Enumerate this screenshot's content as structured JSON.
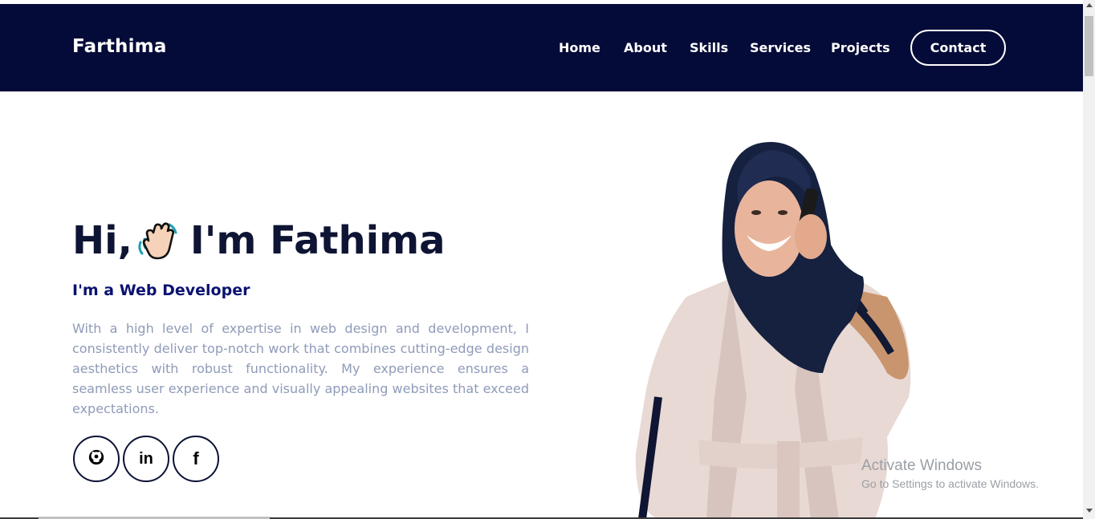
{
  "brand": "Farthima",
  "nav": {
    "home": "Home",
    "about": "About",
    "skills": "Skills",
    "services": "Services",
    "projects": "Projects",
    "contact": "Contact"
  },
  "hero": {
    "greeting_prefix": "Hi,",
    "greeting_suffix": "I'm Fathima",
    "subtitle": "I'm a Web Developer",
    "description": "With a high level of expertise in web design and development, I consistently deliver top-notch work that combines cutting-edge design aesthetics with robust functionality. My experience ensures a seamless user experience and visually appealing websites that exceed expectations."
  },
  "social": [
    {
      "icon": "github-icon"
    },
    {
      "icon": "linkedin-icon",
      "label": "in"
    },
    {
      "icon": "facebook-icon",
      "label": "f"
    }
  ],
  "watermark": {
    "line1": "Activate Windows",
    "line2": "Go to Settings to activate Windows."
  },
  "colors": {
    "navbar_bg": "#050b38",
    "heading": "#0e1433",
    "subtitle": "#0b1270",
    "body_text": "#8f9bb8"
  }
}
